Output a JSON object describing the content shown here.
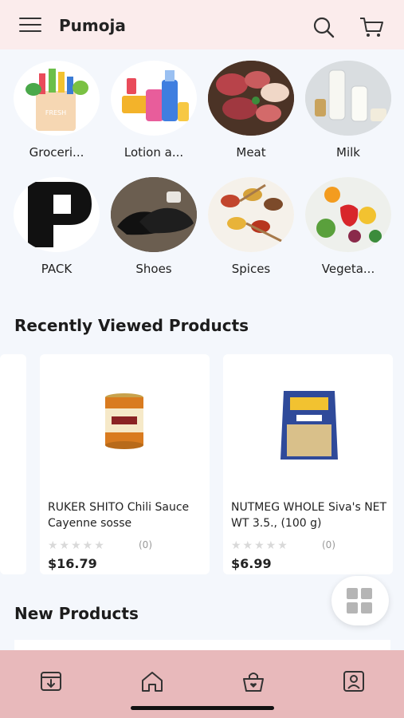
{
  "header": {
    "title": "Pumoja"
  },
  "categories": [
    {
      "label": "Groceri..."
    },
    {
      "label": "Lotion a..."
    },
    {
      "label": "Meat"
    },
    {
      "label": "Milk"
    },
    {
      "label": "PACK"
    },
    {
      "label": "Shoes"
    },
    {
      "label": "Spices"
    },
    {
      "label": "Vegeta..."
    }
  ],
  "recently_viewed": {
    "title": "Recently Viewed Products",
    "products": [
      {
        "name": "RUKER SHITO Chili Sauce Cayenne sosse",
        "stars": "★★★★★",
        "rating_count": "(0)",
        "price": "$16.79"
      },
      {
        "name": "NUTMEG WHOLE Siva's NET WT 3.5., (100 g)",
        "stars": "★★★★★",
        "rating_count": "(0)",
        "price": "$6.99"
      }
    ]
  },
  "new_products": {
    "title": "New Products"
  },
  "colors": {
    "header_bg": "#fbecec",
    "nav_bg": "#e8b9bb",
    "page_bg": "#f4f7fc"
  }
}
